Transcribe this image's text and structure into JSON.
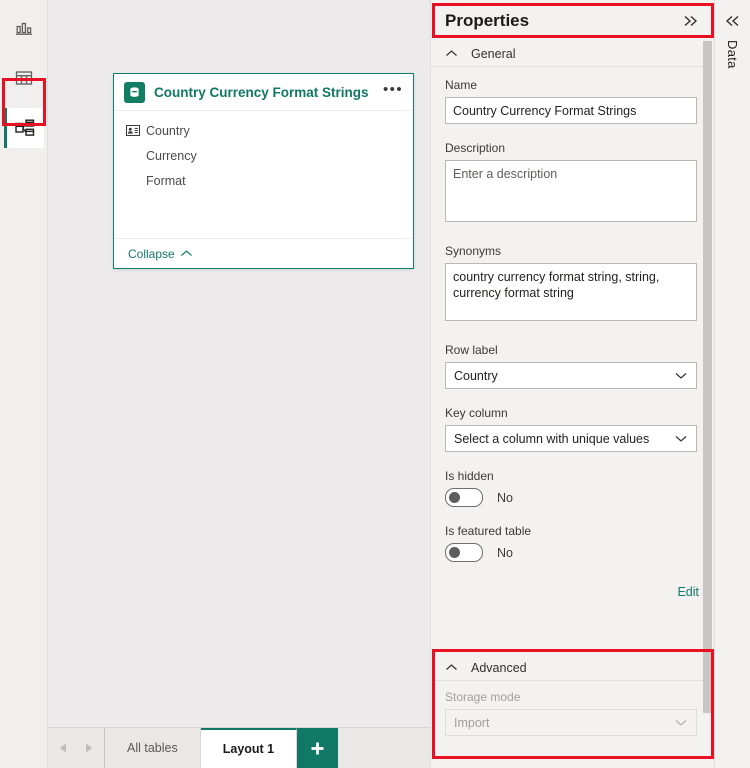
{
  "left_rail": {
    "items": [
      {
        "name": "report-view",
        "icon": "bar-chart-icon",
        "selected": false
      },
      {
        "name": "table-view",
        "icon": "table-grid-icon",
        "selected": false
      },
      {
        "name": "model-view",
        "icon": "model-diagram-icon",
        "selected": true
      }
    ]
  },
  "canvas": {
    "table_card": {
      "title": "Country Currency Format Strings",
      "icon": "table-database-icon",
      "more_label": "•••",
      "fields": [
        {
          "name": "Country",
          "icon": "row-label-card-icon"
        },
        {
          "name": "Currency",
          "icon": ""
        },
        {
          "name": "Format",
          "icon": ""
        }
      ],
      "footer_label": "Collapse",
      "footer_icon": "chevron-up-icon"
    }
  },
  "tabbar": {
    "prev_icon": "chevron-left-icon",
    "next_icon": "chevron-right-icon",
    "tabs": [
      {
        "label": "All tables",
        "active": false
      },
      {
        "label": "Layout 1",
        "active": true
      }
    ],
    "add_label": "+"
  },
  "properties": {
    "title": "Properties",
    "collapse_icon": "chevron-double-right-icon",
    "general": {
      "section_label": "General",
      "chevron": "chevron-up-icon",
      "name_label": "Name",
      "name_value": "Country Currency Format Strings",
      "description_label": "Description",
      "description_value": "",
      "description_placeholder": "Enter a description",
      "synonyms_label": "Synonyms",
      "synonyms_value": "country currency format string, string, currency format string",
      "row_label_label": "Row label",
      "row_label_value": "Country",
      "key_column_label": "Key column",
      "key_column_value": "Select a column with unique values",
      "is_hidden_label": "Is hidden",
      "is_hidden_value": "No",
      "is_featured_label": "Is featured table",
      "is_featured_value": "No",
      "edit_label": "Edit"
    },
    "advanced": {
      "section_label": "Advanced",
      "chevron": "chevron-up-icon",
      "storage_mode_label": "Storage mode",
      "storage_mode_value": "Import"
    }
  },
  "data_rail": {
    "expand_icon": "chevron-double-left-icon",
    "label": "Data"
  },
  "colors": {
    "accent_green": "#117865",
    "card_border": "#118071",
    "annotation_red": "#e81123",
    "panel_bg": "#f3f2f1",
    "canvas_bg": "#eceaea"
  },
  "annotations": [
    {
      "name": "model-view-highlight"
    },
    {
      "name": "properties-header-highlight"
    },
    {
      "name": "advanced-section-highlight"
    }
  ]
}
